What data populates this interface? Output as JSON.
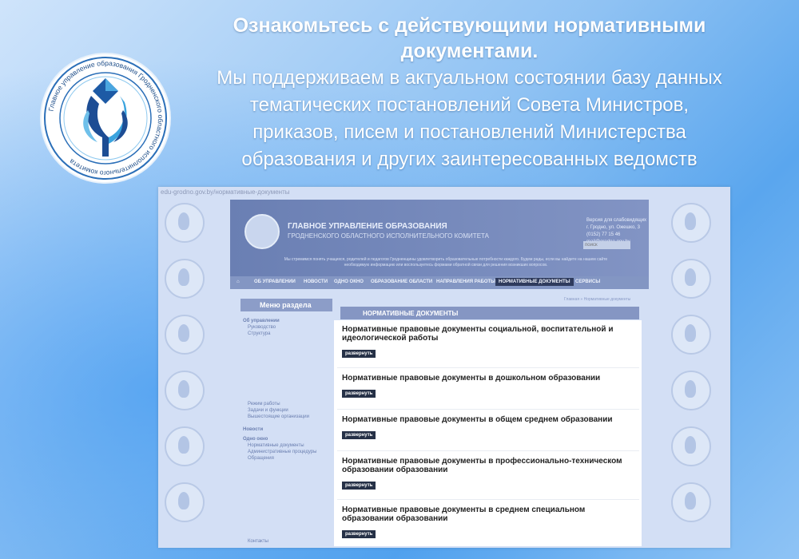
{
  "headline": {
    "bold": "Ознакомьтесь с действующими нормативными документами.",
    "lines": [
      "Мы поддерживаем в актуальном состоянии базу данных",
      "тематических постановлений Совета Министров,",
      "приказов, писем и постановлений Министерства",
      "образования  и других заинтересованных ведомств"
    ]
  },
  "logo": {
    "ring_text": "Главное управление образования Гродненского областного исполнительного комитета"
  },
  "site": {
    "url": "edu-grodno.gov.by/нормативные-документы",
    "title": "ГЛАВНОЕ УПРАВЛЕНИЕ ОБРАЗОВАНИЯ",
    "subtitle": "ГРОДНЕНСКОГО ОБЛАСТНОГО ИСПОЛНИТЕЛЬНОГО КОМИТЕТА",
    "contacts": [
      "Версия для слабовидящих",
      "г. Гродно, ул. Ожешко, 3",
      "(0152) 77 15 46",
      "mail@grodno.gov.by"
    ],
    "search_placeholder": "поиск",
    "slogan": "Мы стремимся понять учащихся, родителей и педагогов Гродненщины удовлетворить образовательные потребности каждого. Будем рады, если вы найдете на нашем сайте необходимую информацию или воспользуетесь формами обратной связи для решения возникших вопросов.",
    "nav": [
      "ОБ УПРАВЛЕНИИ",
      "НОВОСТИ",
      "ОДНО ОКНО",
      "ОБРАЗОВАНИЕ ОБЛАСТИ",
      "НАПРАВЛЕНИЯ РАБОТЫ",
      "НОРМАТИВНЫЕ ДОКУМЕНТЫ",
      "СЕРВИСЫ"
    ],
    "menu_title": "Меню раздела",
    "menu_items": [
      "Об управлении",
      "Руководство",
      "Структура",
      "Режим работы",
      "Задачи и функции",
      "Вышестоящие организации",
      "Новости",
      "Одно окно",
      "Нормативные документы",
      "Административные процедуры",
      "Обращения",
      "Контакты"
    ],
    "breadcrumb": "Главная » Нормативные документы",
    "docs_title": "НОРМАТИВНЫЕ ДОКУМЕНТЫ",
    "expand_label": "развернуть",
    "docs": [
      "Нормативные правовые документы социальной, воспитательной и идеологической работы",
      "Нормативные правовые документы в дошкольном образовании",
      "Нормативные правовые документы в общем среднем образовании",
      "Нормативные правовые документы в профессионально-техническом образовании образовании",
      "Нормативные правовые документы в среднем специальном образовании образовании"
    ]
  },
  "colors": {
    "accent": "#263147",
    "header": "#8596c3"
  }
}
